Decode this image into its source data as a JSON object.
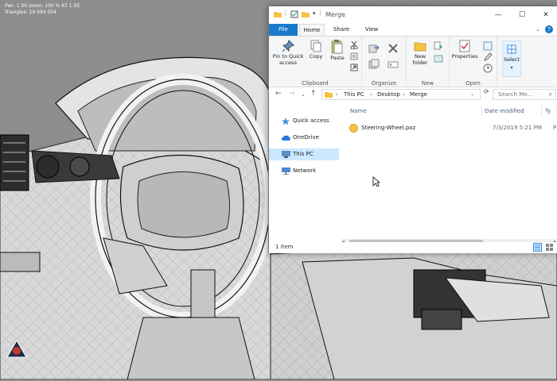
{
  "viewport": {
    "hud_line1": "Pan: 1.00 zoom: 100 % 87 1.05",
    "hud_line2": "Triangles: 19 094 054"
  },
  "window": {
    "title": "Merge",
    "caption": {
      "minimize": "—",
      "maximize": "☐",
      "close": "✕"
    }
  },
  "ribbon": {
    "tabs": [
      "File",
      "Home",
      "Share",
      "View"
    ],
    "active_tab": "Home",
    "toggle": "⌄",
    "help": "?",
    "groups": {
      "clipboard": {
        "label": "Clipboard",
        "pin": "Pin to Quick access",
        "copy": "Copy",
        "paste": "Paste"
      },
      "organize": {
        "label": "Organize"
      },
      "new": {
        "label": "New",
        "new_folder": "New folder"
      },
      "open": {
        "label": "Open",
        "properties": "Properties"
      },
      "select": {
        "label": "Select"
      }
    }
  },
  "address": {
    "back": "←",
    "forward": "→",
    "recent": "⌄",
    "up": "↑",
    "crumbs": [
      "This PC",
      "Desktop",
      "Merge"
    ],
    "search_placeholder": "Search Me..."
  },
  "nav": {
    "items": [
      {
        "label": "Quick access",
        "icon": "star-icon"
      },
      {
        "label": "OneDrive",
        "icon": "cloud-icon"
      },
      {
        "label": "This PC",
        "icon": "computer-icon"
      },
      {
        "label": "Network",
        "icon": "network-icon"
      }
    ]
  },
  "content": {
    "columns": {
      "name": "Name",
      "date": "Date modified",
      "type": "Ty"
    },
    "files": [
      {
        "name": "Steering-Wheel.pxz",
        "date": "7/3/2019 5:21 PM",
        "type": "PX"
      }
    ]
  },
  "status": {
    "count": "1 item"
  },
  "colors": {
    "accent": "#1979ca",
    "selection": "#cce8ff",
    "folder": "#f5c243",
    "viewport_bg": "#8c8c8c"
  }
}
